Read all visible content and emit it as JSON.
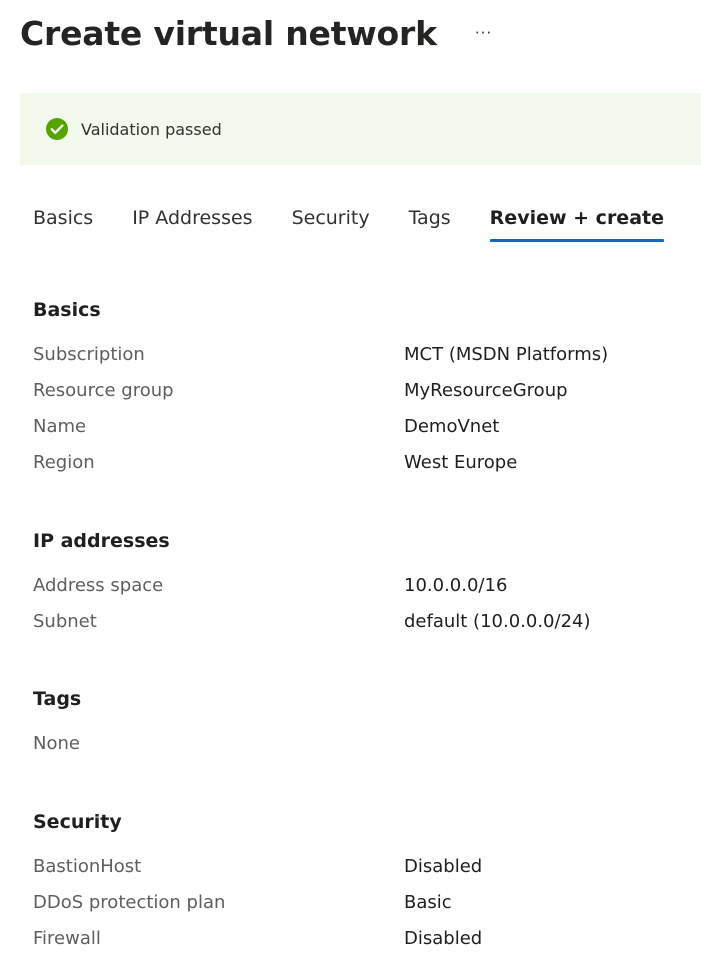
{
  "header": {
    "title": "Create virtual network",
    "more_label": "···"
  },
  "banner": {
    "icon": "check-circle-icon",
    "text": "Validation passed",
    "color": "#57a300"
  },
  "tabs": [
    {
      "label": "Basics",
      "active": false
    },
    {
      "label": "IP Addresses",
      "active": false
    },
    {
      "label": "Security",
      "active": false
    },
    {
      "label": "Tags",
      "active": false
    },
    {
      "label": "Review + create",
      "active": true
    }
  ],
  "sections": {
    "basics": {
      "title": "Basics",
      "rows": [
        {
          "label": "Subscription",
          "value": "MCT (MSDN Platforms)"
        },
        {
          "label": "Resource group",
          "value": "MyResourceGroup"
        },
        {
          "label": "Name",
          "value": "DemoVnet"
        },
        {
          "label": "Region",
          "value": "West Europe"
        }
      ]
    },
    "ip_addresses": {
      "title": "IP addresses",
      "rows": [
        {
          "label": "Address space",
          "value": "10.0.0.0/16"
        },
        {
          "label": "Subnet",
          "value": "default (10.0.0.0/24)"
        }
      ]
    },
    "tags": {
      "title": "Tags",
      "rows": [
        {
          "label": "None",
          "value": ""
        }
      ]
    },
    "security": {
      "title": "Security",
      "rows": [
        {
          "label": "BastionHost",
          "value": "Disabled"
        },
        {
          "label": "DDoS protection plan",
          "value": "Basic"
        },
        {
          "label": "Firewall",
          "value": "Disabled"
        }
      ]
    }
  },
  "colors": {
    "accent": "#0f6cbd",
    "banner_background": "#f3f9ed",
    "label_text": "#605e5c"
  }
}
